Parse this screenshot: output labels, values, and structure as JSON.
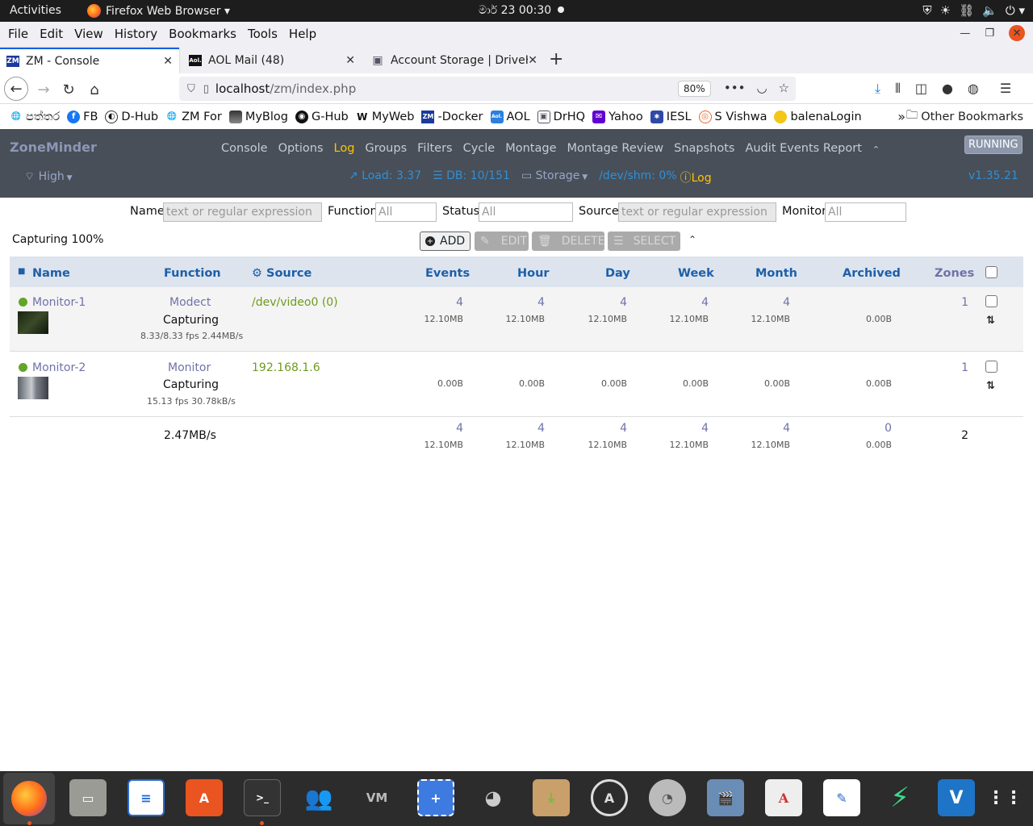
{
  "topbar": {
    "activities": "Activities",
    "app": "Firefox Web Browser ▾",
    "clock": "මාර් 23  00:30"
  },
  "menubar": [
    "File",
    "Edit",
    "View",
    "History",
    "Bookmarks",
    "Tools",
    "Help"
  ],
  "tabs": [
    {
      "label": "ZM - Console",
      "icon": "ZM"
    },
    {
      "label": "AOL Mail (48)",
      "icon": "Aol."
    },
    {
      "label": "Account Storage | DriveH",
      "icon": "▣"
    }
  ],
  "nav": {
    "url_host": "localhost",
    "url_path": "/zm/index.php",
    "zoom": "80%"
  },
  "bookmarks": [
    {
      "label": "පත්තර",
      "icon": "globe-icon"
    },
    {
      "label": "FB",
      "icon": "facebook-icon"
    },
    {
      "label": "D-Hub",
      "icon": "dhub-icon"
    },
    {
      "label": "ZM For",
      "icon": "globe-icon"
    },
    {
      "label": "MyBlog",
      "icon": "image-icon"
    },
    {
      "label": "G-Hub",
      "icon": "github-icon"
    },
    {
      "label": "MyWeb",
      "icon": "w-icon"
    },
    {
      "label": "-Docker",
      "icon": "zm-icon"
    },
    {
      "label": "AOL",
      "icon": "aol-icon"
    },
    {
      "label": "DrHQ",
      "icon": "drhq-icon"
    },
    {
      "label": "Yahoo",
      "icon": "yahoo-icon"
    },
    {
      "label": "IESL",
      "icon": "iesl-icon"
    },
    {
      "label": "S Vishwa",
      "icon": "svishwa-icon"
    },
    {
      "label": "balenaLogin",
      "icon": "balena-icon"
    }
  ],
  "bookmarks_other": "Other Bookmarks",
  "zm": {
    "brand": "ZoneMinder",
    "menu": [
      "Console",
      "Options",
      "Log",
      "Groups",
      "Filters",
      "Cycle",
      "Montage",
      "Montage Review",
      "Snapshots",
      "Audit Events Report"
    ],
    "current_menu": "Log",
    "running": "RUNNING",
    "bandwidth": "High",
    "load": "Load: 3.37",
    "db": "DB: 10/151",
    "storage": "Storage",
    "shm": "/dev/shm: 0%",
    "log": "Log",
    "version": "v1.35.21"
  },
  "filters": {
    "name_label": "Name",
    "name_placeholder": "text or regular expression",
    "function_label": "Function",
    "function_placeholder": "All",
    "status_label": "Status",
    "status_placeholder": "All",
    "source_label": "Source",
    "source_placeholder": "text or regular expression",
    "monitor_label": "Monitor",
    "monitor_placeholder": "All"
  },
  "capturing": "Capturing 100%",
  "actions": {
    "add": "ADD",
    "edit": "EDIT",
    "delete": "DELETE",
    "select": "SELECT"
  },
  "table": {
    "headers": {
      "name": "Name",
      "function": "Function",
      "source": "Source",
      "events": "Events",
      "hour": "Hour",
      "day": "Day",
      "week": "Week",
      "month": "Month",
      "archived": "Archived",
      "zones": "Zones"
    },
    "rows": [
      {
        "name": "Monitor-1",
        "function": "Modect",
        "status": "Capturing",
        "fps": "8.33/8.33 fps 2.44MB/s",
        "source": "/dev/video0 (0)",
        "events": {
          "n": "4",
          "s": "12.10MB"
        },
        "hour": {
          "n": "4",
          "s": "12.10MB"
        },
        "day": {
          "n": "4",
          "s": "12.10MB"
        },
        "week": {
          "n": "4",
          "s": "12.10MB"
        },
        "month": {
          "n": "4",
          "s": "12.10MB"
        },
        "archived": {
          "n": "",
          "s": "0.00B"
        },
        "zones": "1"
      },
      {
        "name": "Monitor-2",
        "function": "Monitor",
        "status": "Capturing",
        "fps": "15.13 fps 30.78kB/s",
        "source": "192.168.1.6",
        "events": {
          "n": "",
          "s": "0.00B"
        },
        "hour": {
          "n": "",
          "s": "0.00B"
        },
        "day": {
          "n": "",
          "s": "0.00B"
        },
        "week": {
          "n": "",
          "s": "0.00B"
        },
        "month": {
          "n": "",
          "s": "0.00B"
        },
        "archived": {
          "n": "",
          "s": "0.00B"
        },
        "zones": "1"
      }
    ],
    "footer": {
      "bandwidth": "2.47MB/s",
      "events": {
        "n": "4",
        "s": "12.10MB"
      },
      "hour": {
        "n": "4",
        "s": "12.10MB"
      },
      "day": {
        "n": "4",
        "s": "12.10MB"
      },
      "week": {
        "n": "4",
        "s": "12.10MB"
      },
      "month": {
        "n": "4",
        "s": "12.10MB"
      },
      "archived": {
        "n": "0",
        "s": "0.00B"
      },
      "zones": "2"
    }
  },
  "colors": {
    "accent": "#0060df",
    "zm_header": "#484f58",
    "zm_link": "#6f72a8",
    "zm_active": "#ffc400",
    "status_blue": "#2f8fd8",
    "ok_green": "#63a52a"
  }
}
